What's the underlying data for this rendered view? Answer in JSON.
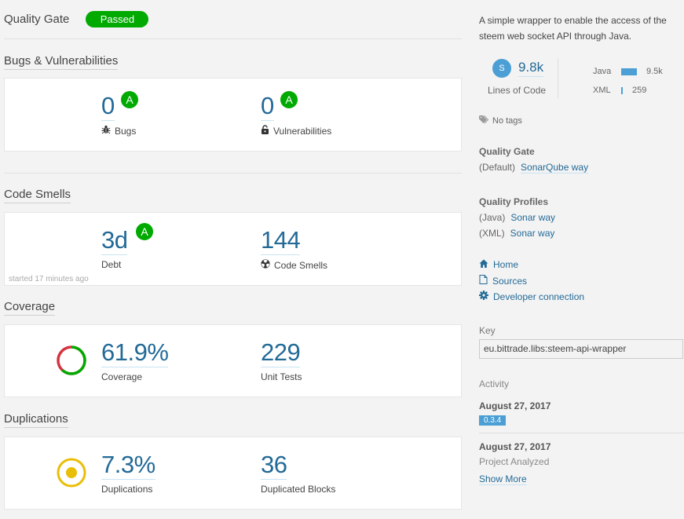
{
  "quality_gate": {
    "title": "Quality Gate",
    "status": "Passed",
    "status_color": "#00aa00"
  },
  "sections": {
    "bugs_vulns": {
      "title": "Bugs & Vulnerabilities",
      "bugs": {
        "value": "0",
        "rating": "A",
        "label": "Bugs",
        "icon": "bug-icon"
      },
      "vulnerabilities": {
        "value": "0",
        "rating": "A",
        "label": "Vulnerabilities",
        "icon": "lock-icon"
      }
    },
    "code_smells": {
      "title": "Code Smells",
      "debt": {
        "value": "3d",
        "rating": "A",
        "label": "Debt"
      },
      "smells": {
        "value": "144",
        "label": "Code Smells",
        "icon": "radiation-icon"
      },
      "started": "started 17 minutes ago"
    },
    "coverage": {
      "title": "Coverage",
      "coverage": {
        "value": "61.9%",
        "label": "Coverage",
        "percent": 61.9
      },
      "tests": {
        "value": "229",
        "label": "Unit Tests"
      }
    },
    "duplications": {
      "title": "Duplications",
      "duplications": {
        "value": "7.3%",
        "label": "Duplications",
        "percent": 7.3
      },
      "blocks": {
        "value": "36",
        "label": "Duplicated Blocks"
      }
    }
  },
  "sidebar": {
    "description": "A simple wrapper to enable the access of the steem web socket API through Java.",
    "size_rating": "S",
    "lines_of_code": {
      "value": "9.8k",
      "label": "Lines of Code"
    },
    "languages": [
      {
        "name": "Java",
        "value": "9.5k",
        "fraction": 0.97
      },
      {
        "name": "XML",
        "value": "259",
        "fraction": 0.03
      }
    ],
    "tags": "No tags",
    "quality_gate": {
      "title": "Quality Gate",
      "prefix": "(Default)",
      "link": "SonarQube way"
    },
    "quality_profiles": {
      "title": "Quality Profiles",
      "items": [
        {
          "lang": "(Java)",
          "link": "Sonar way"
        },
        {
          "lang": "(XML)",
          "link": "Sonar way"
        }
      ]
    },
    "links": [
      {
        "label": "Home",
        "icon": "home-icon"
      },
      {
        "label": "Sources",
        "icon": "file-icon"
      },
      {
        "label": "Developer connection",
        "icon": "gear-icon"
      }
    ],
    "key": {
      "title": "Key",
      "value": "eu.bittrade.libs:steem-api-wrapper"
    },
    "activity": {
      "title": "Activity",
      "events": [
        {
          "date": "August 27, 2017",
          "version": "0.3.4"
        },
        {
          "date": "August 27, 2017",
          "text": "Project Analyzed"
        }
      ],
      "show_more": "Show More"
    }
  }
}
